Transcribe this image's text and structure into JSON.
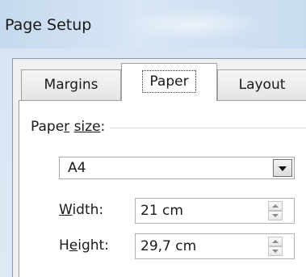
{
  "window": {
    "title": "Page Setup"
  },
  "tabs": [
    {
      "label": "Margins",
      "selected": false
    },
    {
      "label": "Paper",
      "selected": true
    },
    {
      "label": "Layout",
      "selected": false
    }
  ],
  "paper_size": {
    "label_prefix": "Pape",
    "label_mnemonic": "r",
    "label_space": " ",
    "label_underlined_word": "size",
    "label_suffix": ":",
    "value": "A4"
  },
  "width": {
    "label_mnemonic": "W",
    "label_rest": "idth:",
    "value": "21 cm"
  },
  "height": {
    "label_start": "H",
    "label_mnemonic": "e",
    "label_rest": "ight:",
    "value": "29,7 cm"
  },
  "colors": {
    "title_bar": "#c9dcef",
    "panel": "#ffffff",
    "dialog": "#f0f0f0"
  },
  "icons": {
    "dropdown": "chevron-down-icon",
    "spin_up": "arrow-up-icon",
    "spin_down": "arrow-down-icon"
  }
}
